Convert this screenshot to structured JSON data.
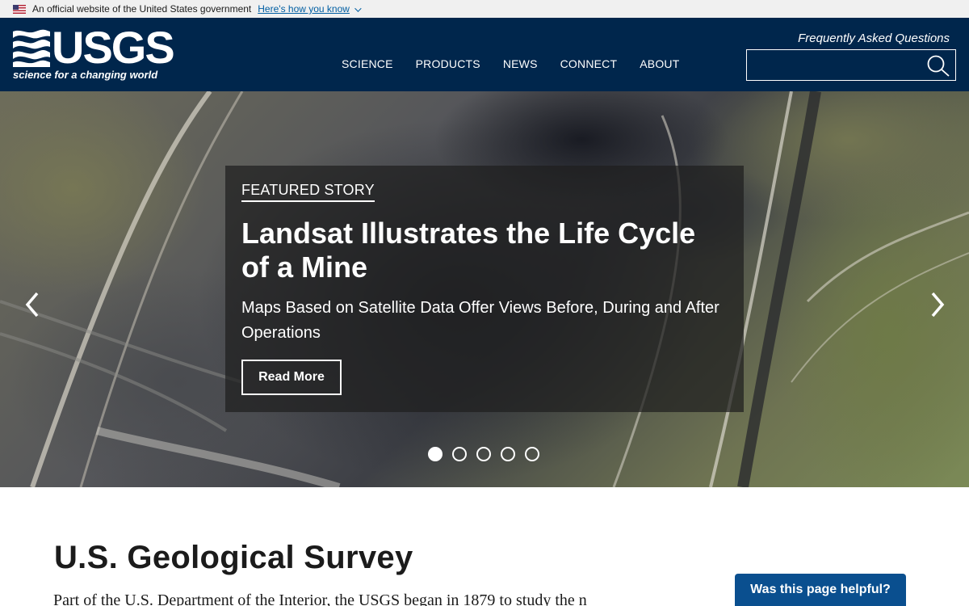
{
  "gov_banner": {
    "text": "An official website of the United States government",
    "link": "Here's how you know"
  },
  "header": {
    "logo_text": "USGS",
    "logo_tagline": "science for a changing world",
    "nav": [
      "SCIENCE",
      "PRODUCTS",
      "NEWS",
      "CONNECT",
      "ABOUT"
    ],
    "faq_link": "Frequently Asked Questions",
    "search": {
      "value": "",
      "placeholder": ""
    }
  },
  "hero": {
    "kicker": "FEATURED STORY",
    "title": "Landsat Illustrates the Life Cycle of a Mine",
    "subtitle": "Maps Based on Satellite Data Offer Views Before, During and After Operations",
    "button": "Read More",
    "slides_total": 5,
    "active_slide": 1
  },
  "main": {
    "title": "U.S. Geological Survey",
    "intro": "Part of the U.S. Department of the Interior, the USGS began in 1879 to study the n"
  },
  "feedback": {
    "label": "Was this page helpful?"
  },
  "colors": {
    "header_bg": "#00264c",
    "feedback_bg": "#0a4f8f",
    "gov_banner_bg": "#f0f0f0"
  }
}
